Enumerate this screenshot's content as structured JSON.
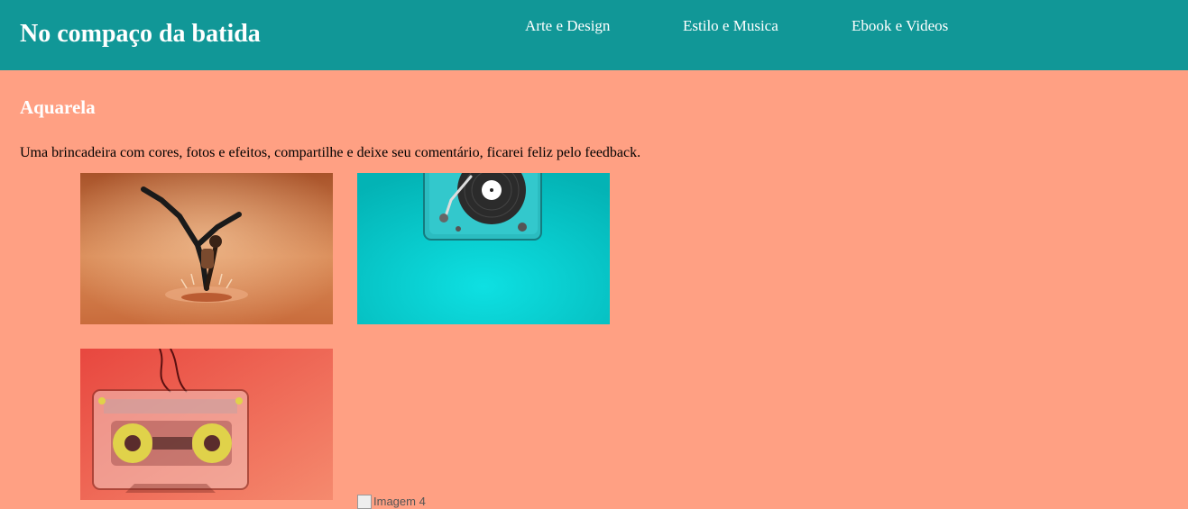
{
  "header": {
    "site_title": "No compaço da batida",
    "nav": [
      {
        "label": "Arte e Design"
      },
      {
        "label": "Estilo e Musica"
      },
      {
        "label": "Ebook e Videos"
      }
    ]
  },
  "main": {
    "section_title": "Aquarela",
    "description": "Uma brincadeira com cores, fotos e efeitos, compartilhe e deixe seu comentário, ficarei feliz pelo feedback.",
    "images": [
      {
        "icon": "dancer-photo"
      },
      {
        "icon": "turntable-photo"
      },
      {
        "icon": "cassette-photo"
      },
      {
        "icon": "broken-image-icon",
        "alt_text": "Imagem 4"
      }
    ]
  },
  "colors": {
    "header_bg": "#119797",
    "page_bg": "#ffa083",
    "header_text": "#ffffff"
  }
}
